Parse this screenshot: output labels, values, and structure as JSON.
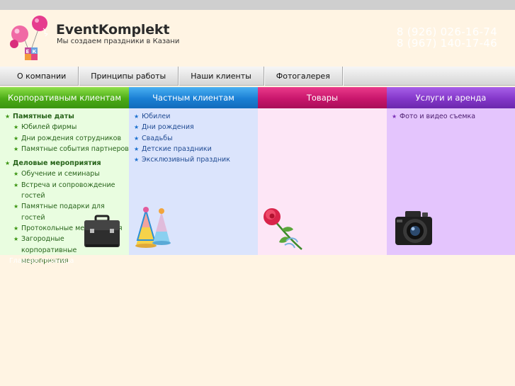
{
  "brand": {
    "name": "EventKomplekt",
    "slogan": "Мы создаем праздники в Казани",
    "logo_letters": "ЕК"
  },
  "phones": [
    "8 (926) 026-16-74",
    "8 (967) 140-17-46"
  ],
  "nav": [
    {
      "label": "О компании"
    },
    {
      "label": "Принципы работы"
    },
    {
      "label": "Наши клиенты"
    },
    {
      "label": "Фотогалерея"
    }
  ],
  "categories": [
    {
      "label": "Корпоративным клиентам"
    },
    {
      "label": "Частным клиентам"
    },
    {
      "label": "Товары"
    },
    {
      "label": "Услуги и аренда"
    }
  ],
  "corporate": {
    "group1": {
      "title": "Памятные даты",
      "items": [
        "Юбилей фирмы",
        "Дни рождения сотрудников",
        "Памятные события партнеров"
      ]
    },
    "group2": {
      "title": "Деловые мероприятия",
      "items": [
        "Обучение и семинары",
        "Встреча и сопровождение гостей",
        "Памятные подарки для гостей",
        "Протокольные мероприятия",
        "Загородные корпоративные мероприятия"
      ]
    }
  },
  "private": {
    "items": [
      "Юбилеи",
      "Дни рождения",
      "Свадьбы",
      "Детские праздники",
      "Эксклюзивный праздник"
    ]
  },
  "services": {
    "items": [
      "Фото и видео съемка"
    ]
  },
  "footer": {
    "link": "Главная страница"
  },
  "colors": {
    "page_bg": "#fff4e3",
    "corporate": "#4bab16",
    "private": "#1a7fd4",
    "goods": "#c8166c",
    "services": "#8437c9"
  },
  "icons": [
    "balloons-logo-icon",
    "star-bullet-icon",
    "briefcase-icon",
    "party-hats-icon",
    "rose-icon",
    "camera-icon"
  ]
}
